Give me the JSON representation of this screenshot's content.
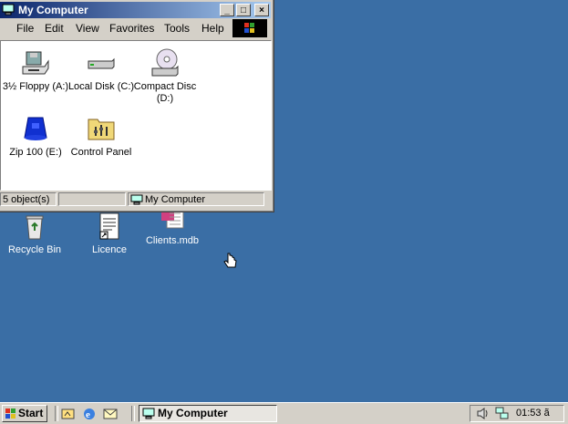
{
  "desktop": {
    "icons": [
      {
        "label": "Recycle Bin",
        "icon": "recycle-bin-icon"
      },
      {
        "label": "Licence",
        "icon": "document-shortcut-icon"
      },
      {
        "label": "Clients.mdb",
        "icon": "access-database-icon"
      }
    ]
  },
  "window": {
    "title": "My Computer",
    "controls": {
      "minimize": "_",
      "maximize": "□",
      "close": "×"
    },
    "menu": [
      "File",
      "Edit",
      "View",
      "Favorites",
      "Tools",
      "Help"
    ],
    "items": [
      {
        "label": "3½ Floppy (A:)",
        "icon": "floppy-drive-icon"
      },
      {
        "label": "Local Disk (C:)",
        "icon": "hard-disk-icon"
      },
      {
        "label": "Compact Disc (D:)",
        "icon": "cd-drive-icon"
      },
      {
        "label": "Zip 100 (E:)",
        "icon": "zip-drive-icon"
      },
      {
        "label": "Control Panel",
        "icon": "control-panel-icon"
      }
    ],
    "status": {
      "objects": "5 object(s)",
      "location": "My Computer"
    }
  },
  "taskbar": {
    "start_label": "Start",
    "quick_launch": [
      "show-desktop-icon",
      "internet-explorer-icon",
      "outlook-express-icon"
    ],
    "task_label": "My Computer",
    "clock": "01:53 ã"
  },
  "colors": {
    "desktop": "#3a6ea5",
    "title_start": "#0a246a",
    "title_end": "#a6caf0",
    "face": "#d4d0c8"
  }
}
